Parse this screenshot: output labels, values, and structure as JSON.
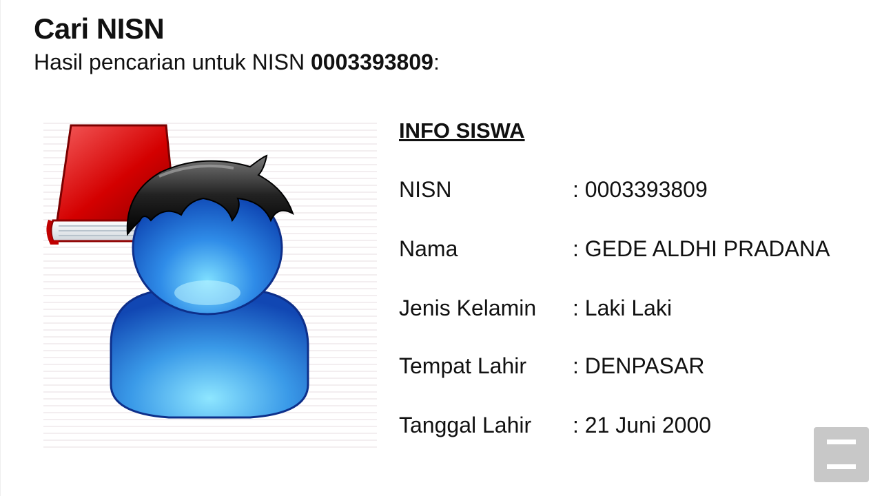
{
  "header": {
    "title": "Cari NISN",
    "subtitle_prefix": "Hasil pencarian untuk NISN ",
    "subtitle_nisn": "0003393809",
    "subtitle_suffix": ":"
  },
  "avatar": {
    "icon": "student-user-icon",
    "book_color": "#d40000",
    "body_color": "#1a6fd4"
  },
  "info": {
    "heading": "INFO SISWA",
    "rows": [
      {
        "label": "NISN",
        "value": ": 0003393809"
      },
      {
        "label": "Nama",
        "value": ": GEDE ALDHI PRADANA"
      },
      {
        "label": "Jenis Kelamin",
        "value": ": Laki Laki"
      },
      {
        "label": "Tempat Lahir",
        "value": ": DENPASAR"
      },
      {
        "label": "Tanggal Lahir",
        "value": ": 21 Juni 2000"
      }
    ]
  },
  "menu_button": {
    "icon": "hamburger-menu-icon",
    "color": "#c8c8c8"
  }
}
